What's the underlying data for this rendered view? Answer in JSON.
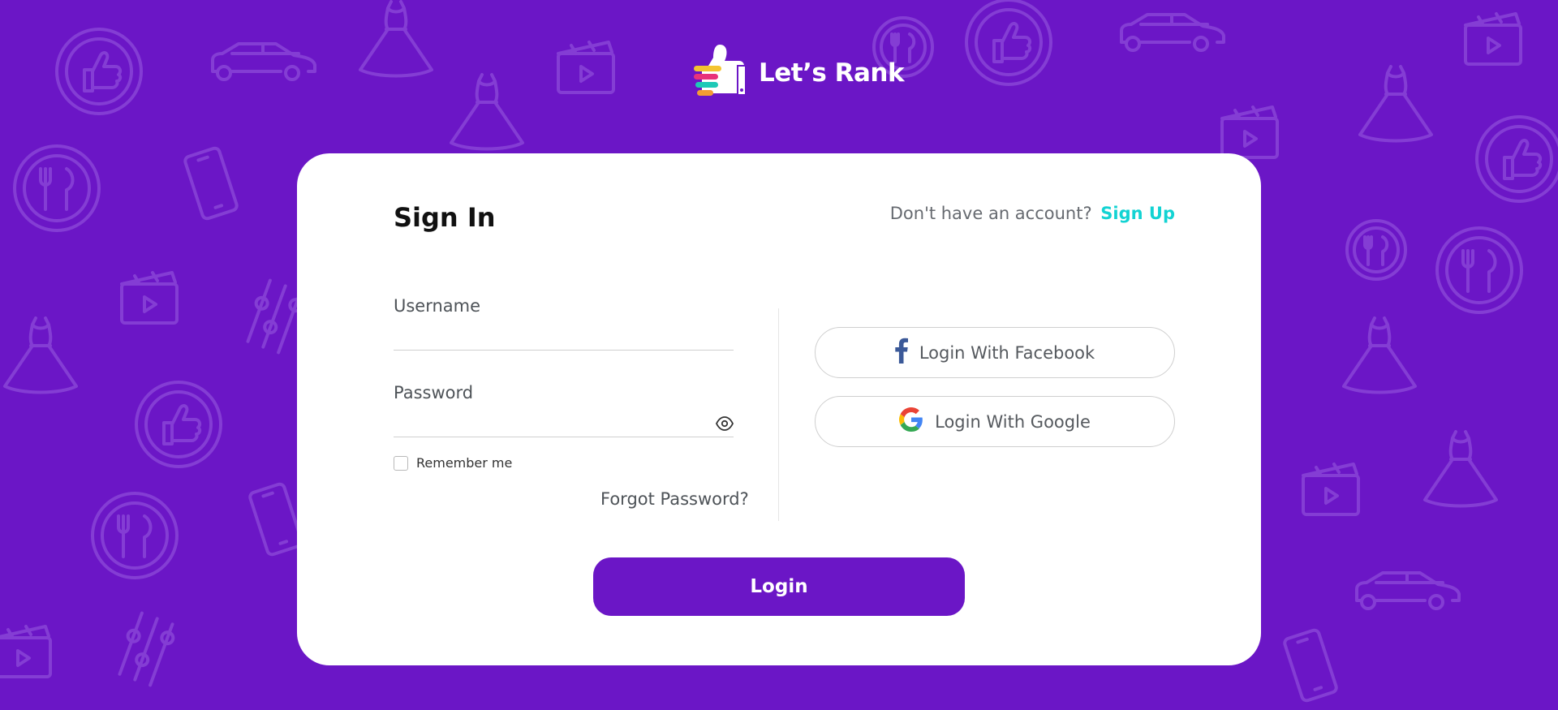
{
  "brand": {
    "name": "Let’s Rank",
    "background_color": "#6b16c6",
    "accent_color": "#13d3d3"
  },
  "signin": {
    "title": "Sign In",
    "no_account_text": "Don't have an account?",
    "signup_label": "Sign Up",
    "username_label": "Username",
    "username_value": "",
    "password_label": "Password",
    "password_value": "",
    "remember_label": "Remember me",
    "remember_checked": false,
    "forgot_label": "Forgot Password?",
    "facebook_label": "Login With Facebook",
    "google_label": "Login With Google",
    "login_label": "Login"
  },
  "icons": {
    "logo": "thumbs-up-logo-icon",
    "facebook": "facebook-icon",
    "google": "google-icon",
    "eye": "eye-icon"
  }
}
